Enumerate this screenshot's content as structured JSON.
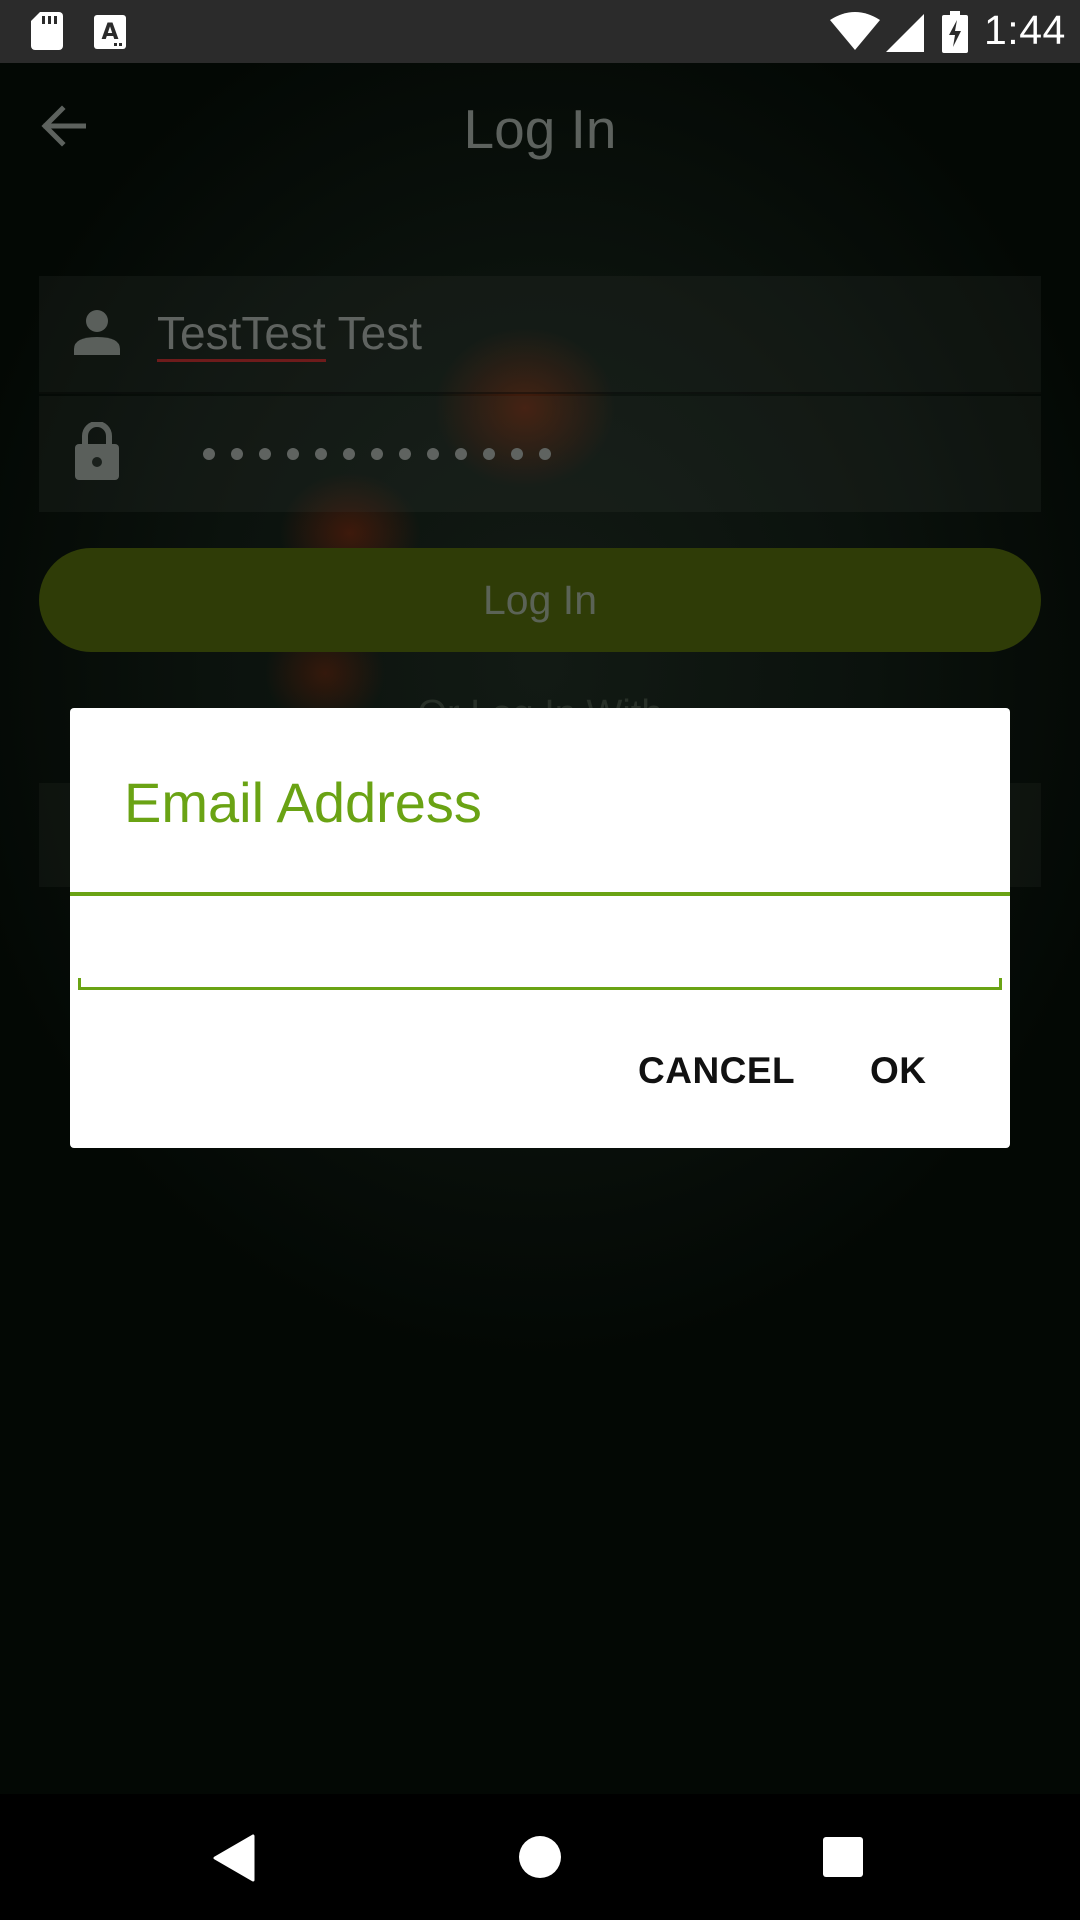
{
  "status_bar": {
    "time": "1:44",
    "icons": [
      "sd-card-icon",
      "text-a-icon",
      "wifi-icon",
      "signal-icon",
      "battery-charging-icon"
    ]
  },
  "app_bar": {
    "title": "Log In",
    "back_icon": "arrow-back-icon"
  },
  "login_form": {
    "username_value": "TestTest Test",
    "username_misspelled": "TestTest",
    "username_rest": " Test",
    "password_mask_count": 13,
    "login_button_label": "Log In",
    "alt_login_text": "Or Log In With"
  },
  "dialog": {
    "title": "Email Address",
    "email_value": "",
    "cancel_label": "CANCEL",
    "ok_label": "OK",
    "accent_color": "#6aa314"
  },
  "nav_bar": {
    "icons": [
      "nav-back-icon",
      "nav-home-icon",
      "nav-recents-icon"
    ]
  }
}
